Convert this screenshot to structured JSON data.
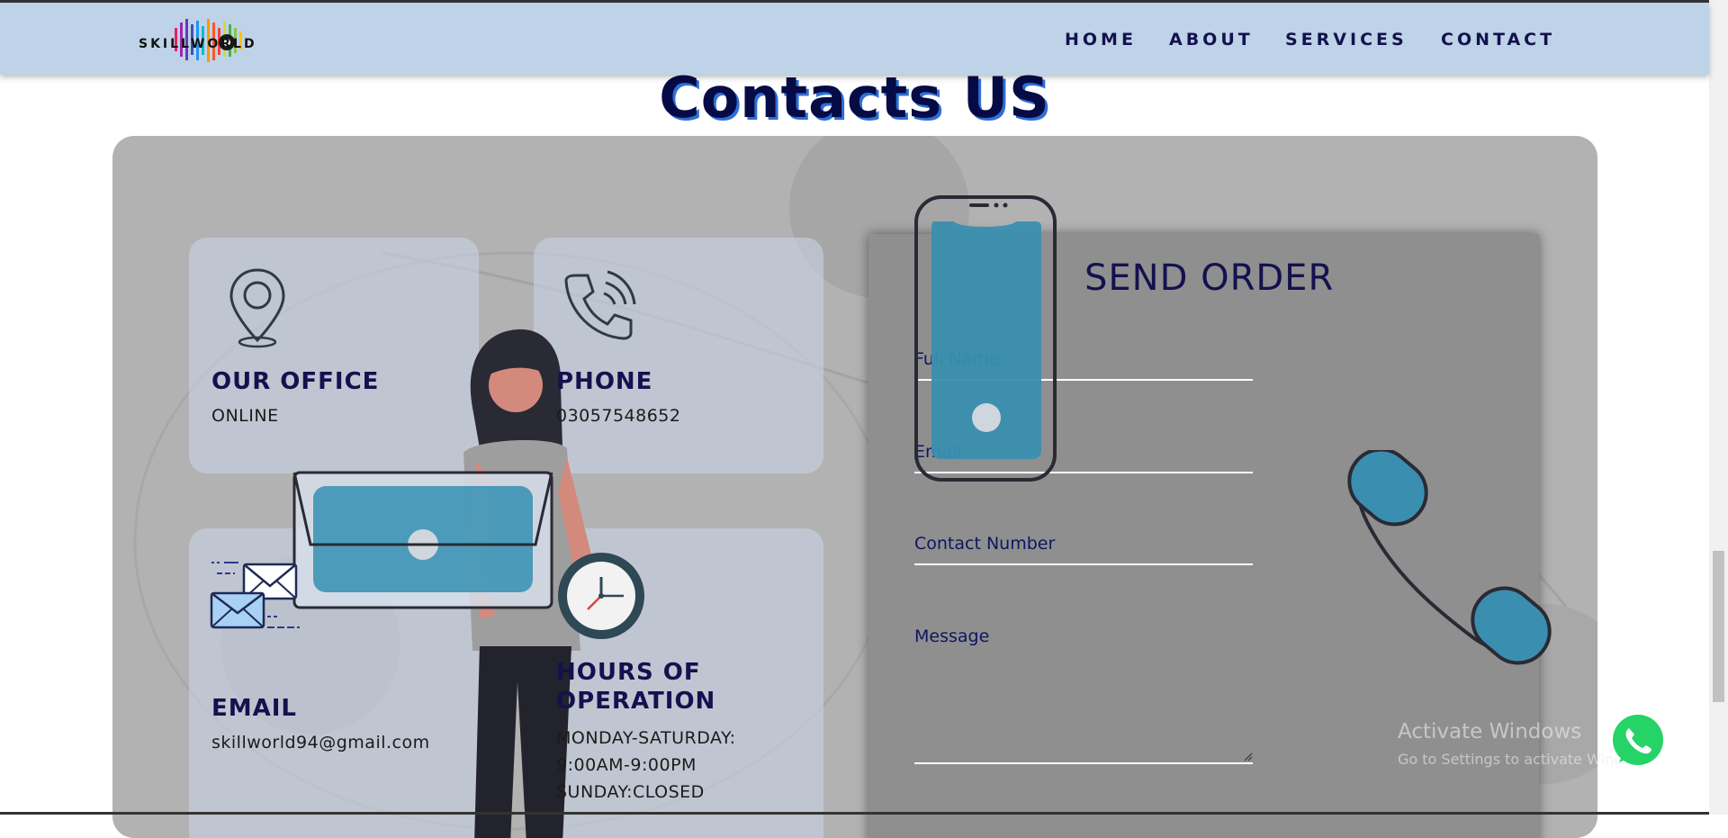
{
  "nav": {
    "logo_text": "SKILLWORLD",
    "links": [
      "HOME",
      "ABOUT",
      "SERVICES",
      "CONTACT"
    ]
  },
  "page": {
    "title": "Contacts US"
  },
  "cards": {
    "office": {
      "title": "OUR OFFICE",
      "text": "ONLINE",
      "icon": "location-pin-icon"
    },
    "phone": {
      "title": "PHONE",
      "text": "03057548652",
      "icon": "phone-icon"
    },
    "email": {
      "title": "EMAIL",
      "text": "skillworld94@gmail.com",
      "icon": "envelope-icon"
    },
    "hours": {
      "title_line1": "HOURS OF",
      "title_line2": "OPERATION",
      "line1": "MONDAY-SATURDAY:",
      "line2": "9:00AM-9:00PM",
      "line3": "SUNDAY:CLOSED",
      "icon": "clock-icon"
    }
  },
  "form": {
    "title": "SEND ORDER",
    "fields": {
      "full_name": "Full Name",
      "email": "Email",
      "contact_number": "Contact Number",
      "message": "Message"
    }
  },
  "watermark": {
    "line1": "Activate Windows",
    "line2": "Go to Settings to activate Windows."
  },
  "colors": {
    "navbar": "#bed3e7",
    "nav_text": "#14114f",
    "panel": "#b2b2b2",
    "form_panel": "#8f8f8f",
    "accent_blue": "#3a8fb0",
    "title_shadow": "#2f6fd6",
    "whatsapp": "#25d366"
  }
}
